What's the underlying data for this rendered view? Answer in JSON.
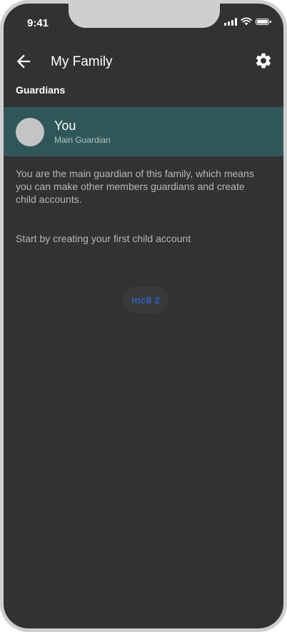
{
  "status_bar": {
    "time": "9:41"
  },
  "app_bar": {
    "title": "My Family",
    "back_icon": "arrow-left-icon",
    "settings_icon": "gear-icon"
  },
  "guardians": {
    "section_title": "Guardians",
    "items": [
      {
        "name": "You",
        "role": "Main Guardian"
      }
    ]
  },
  "content": {
    "description": "You are the main guardian of this family, which means you can make other members guardians and create child accounts.",
    "prompt": "Start by creating your first child account",
    "button_label": "mc8 2"
  },
  "colors": {
    "background": "#323232",
    "highlight_row": "#2f5759",
    "button_text": "#2f5fb8",
    "frame": "#cfcfcf"
  }
}
